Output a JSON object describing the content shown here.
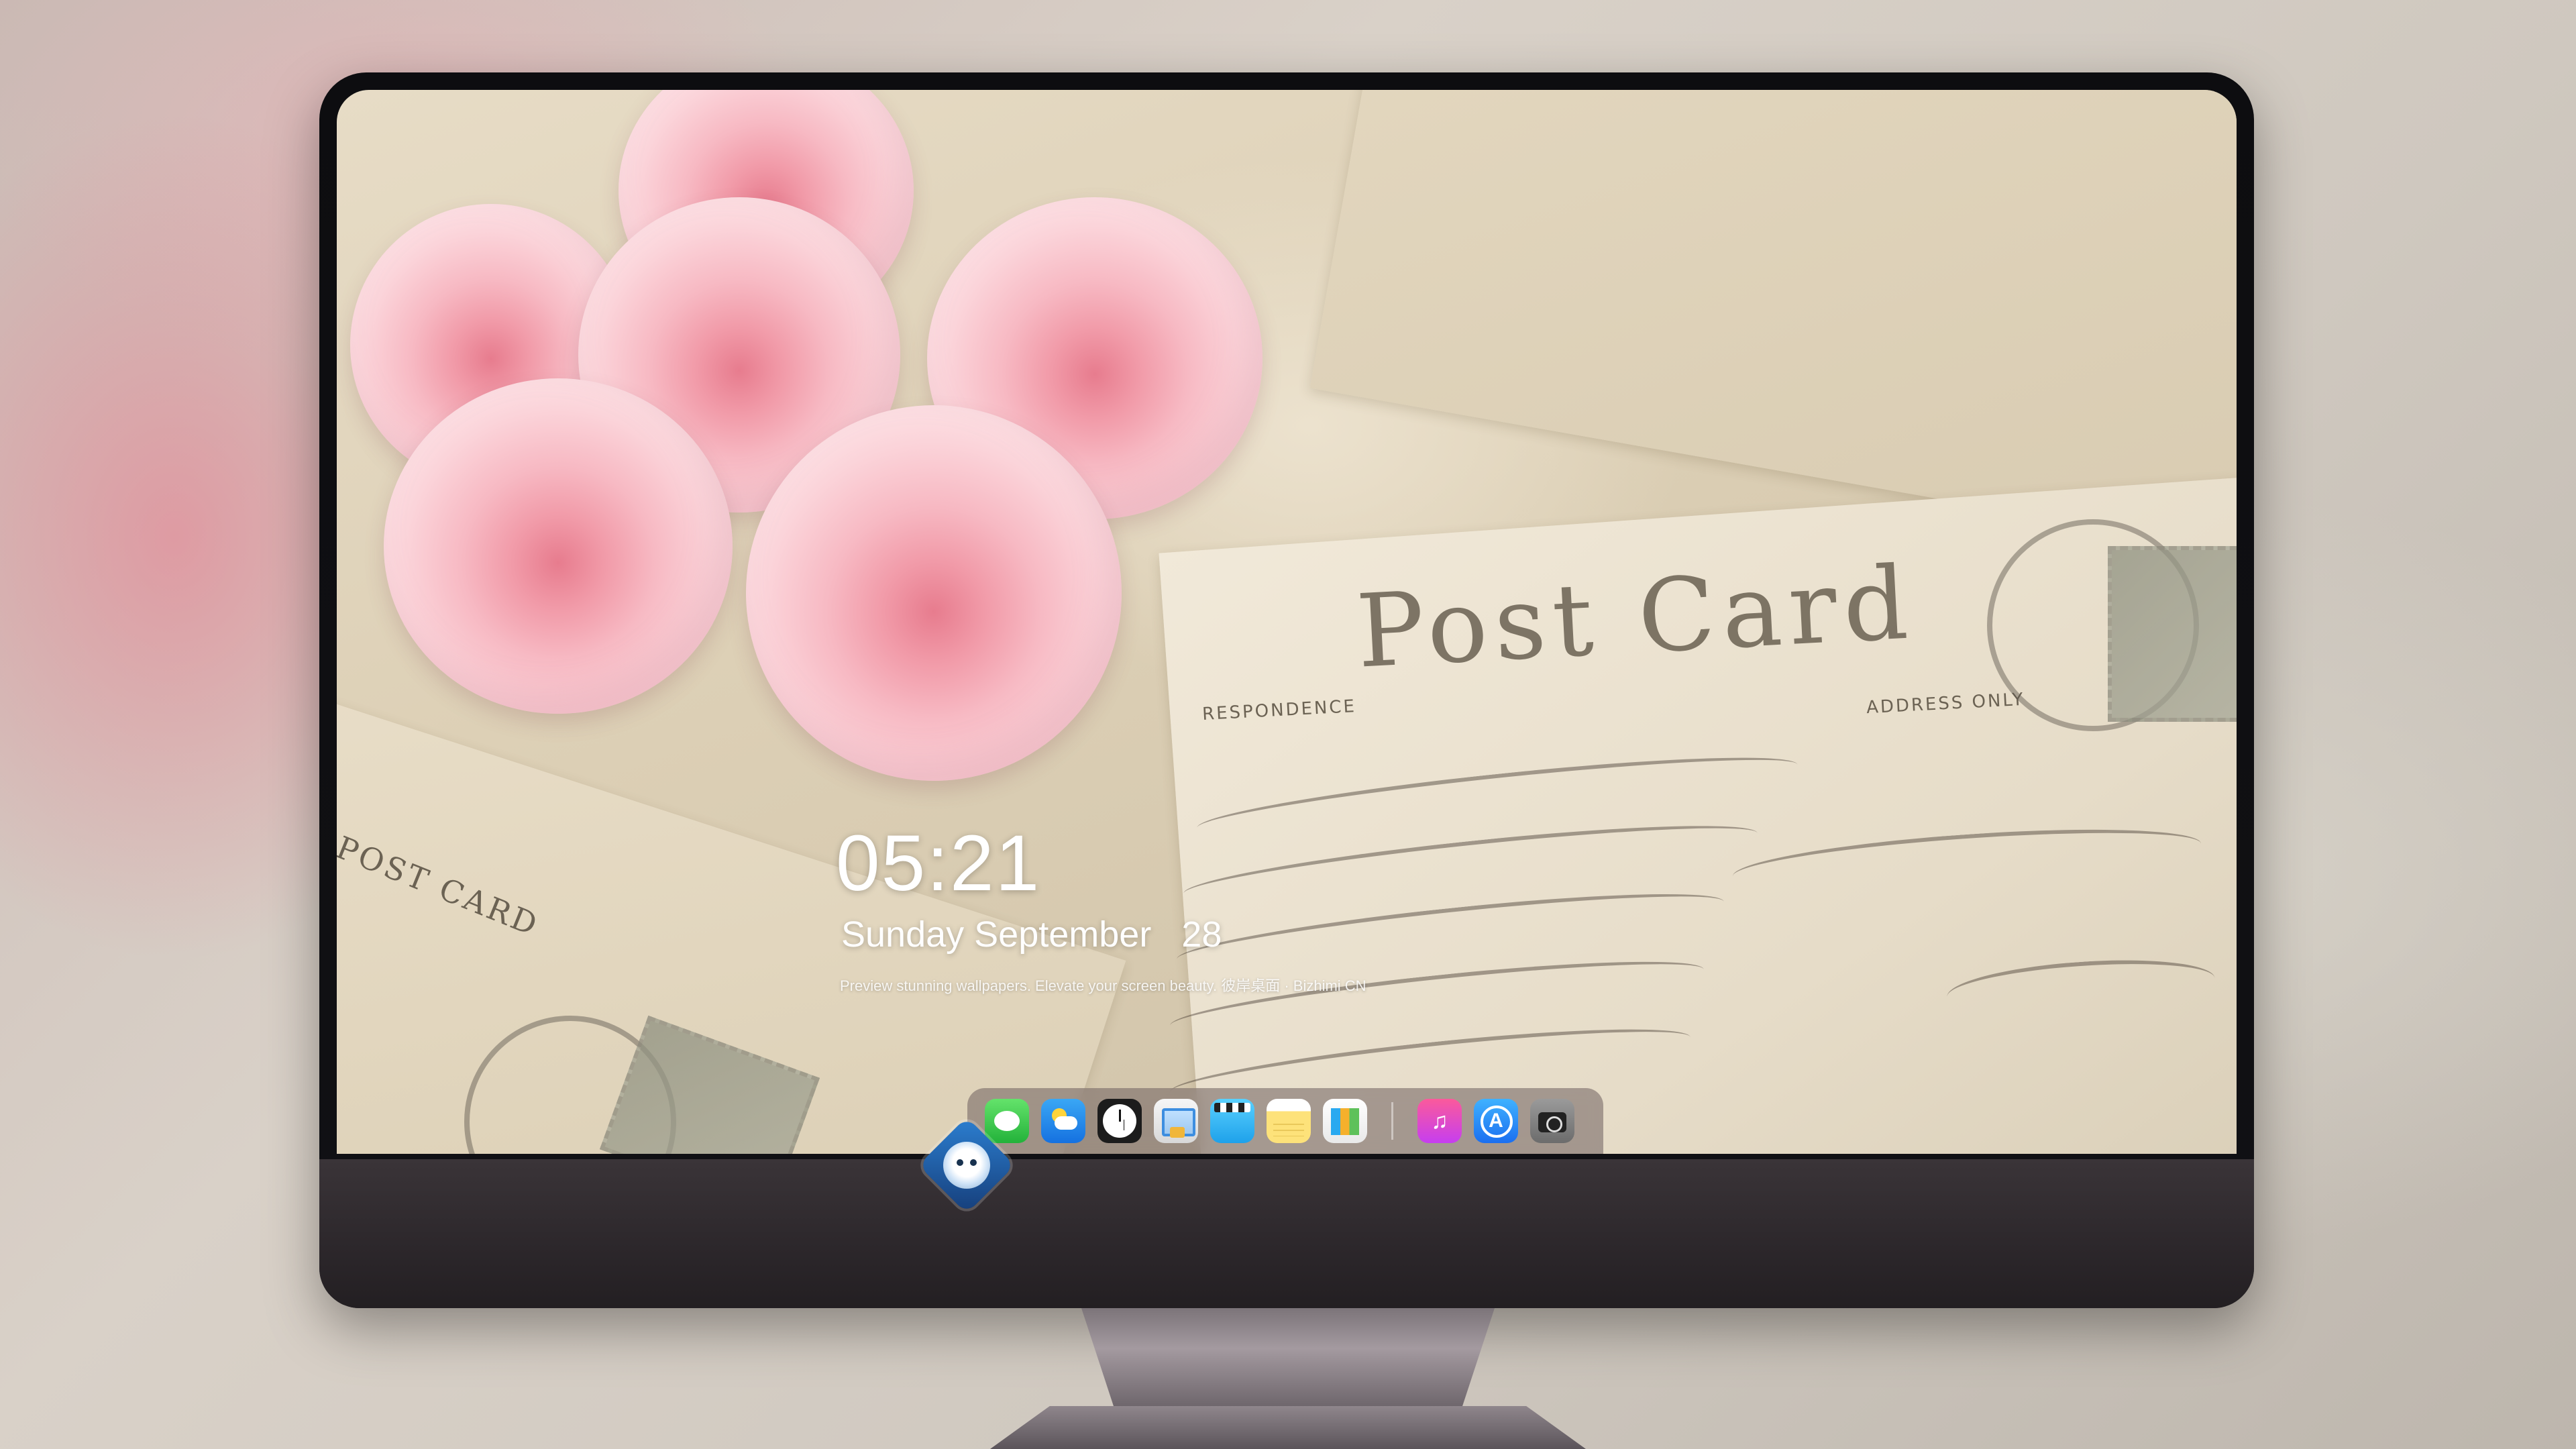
{
  "lockscreen": {
    "time": "05:21",
    "date": "Sunday September   28",
    "tagline": "Preview stunning wallpapers. Elevate your screen beauty. 彼岸桌面 · Bizhimi CN"
  },
  "wallpaper": {
    "card_heading": "Post Card",
    "card_caption": "ADDRESS ONLY",
    "card_caption_left": "RESPONDENCE",
    "side_card_text": "POST CARD"
  },
  "dock": {
    "apps": [
      {
        "name": "Messages",
        "icon": "messages-icon"
      },
      {
        "name": "Weather",
        "icon": "weather-icon"
      },
      {
        "name": "Clock",
        "icon": "clock-icon"
      },
      {
        "name": "Preview",
        "icon": "preview-icon"
      },
      {
        "name": "Clips",
        "icon": "clips-icon"
      },
      {
        "name": "Notes",
        "icon": "notes-icon"
      },
      {
        "name": "Numbers",
        "icon": "numbers-icon"
      },
      {
        "name": "iTunes",
        "icon": "music-icon",
        "glyph": "♫"
      },
      {
        "name": "App Store",
        "icon": "app-store-icon",
        "glyph": "A"
      },
      {
        "name": "Camera",
        "icon": "camera-icon"
      }
    ]
  },
  "colors": {
    "monitor_bezel": "#111114",
    "monitor_chin": "#2c272b",
    "rose_pink": "#f7b9c3",
    "paper": "#e7dcc6"
  }
}
